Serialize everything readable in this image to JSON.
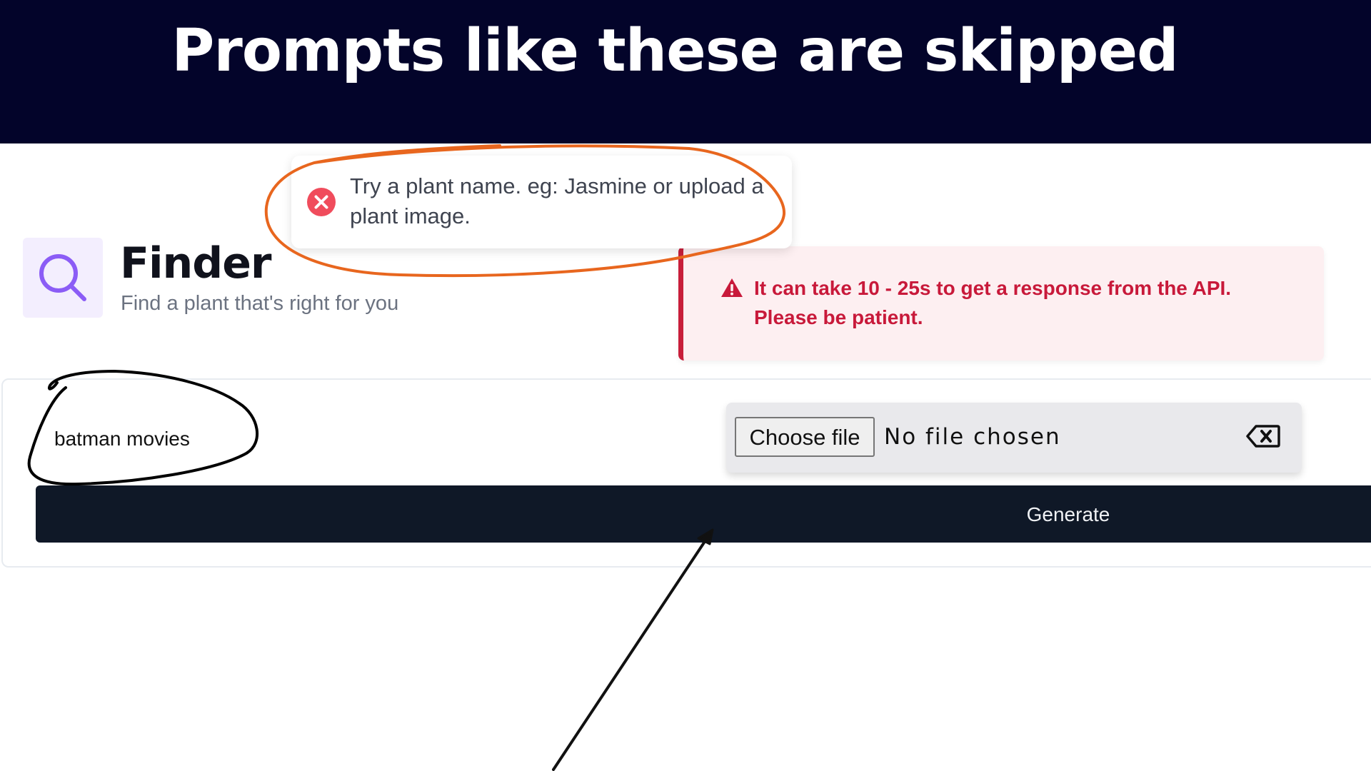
{
  "banner": {
    "title": "Prompts like these are skipped"
  },
  "toast": {
    "icon": "error-circle-icon",
    "message": "Try a plant name. eg: Jasmine or upload a plant image.",
    "icon_color": "#f04c5c"
  },
  "finder": {
    "icon": "search-icon",
    "title": "Finder",
    "subtitle": "Find a plant that's right for you",
    "accent_color": "#8b5cf6"
  },
  "alert": {
    "icon": "warning-triangle-icon",
    "message": "It can take 10 - 25s to get a response from the API. Please be patient.",
    "color": "#c8193a"
  },
  "form": {
    "prompt_value": "batman movies",
    "file_button_label": "Choose file",
    "file_status": "No file chosen",
    "clear_icon": "backspace-icon",
    "generate_label": "Generate"
  },
  "annotations": {
    "toast_circle_color": "#e8661e",
    "prompt_circle_color": "#000000",
    "arrow_color": "#111111"
  }
}
